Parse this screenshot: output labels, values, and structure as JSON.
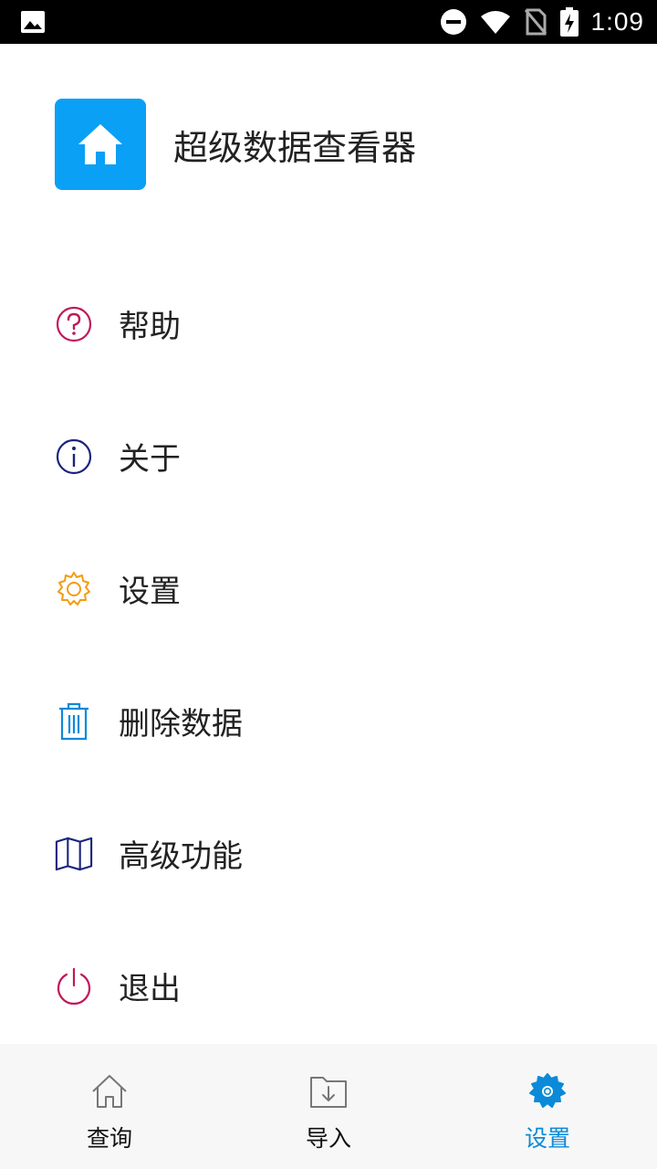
{
  "status_bar": {
    "time": "1:09"
  },
  "header": {
    "app_title": "超级数据查看器",
    "icon": "home-icon"
  },
  "menu": {
    "items": [
      {
        "label": "帮助",
        "icon": "help-circle-icon",
        "color": "#c2185b"
      },
      {
        "label": "关于",
        "icon": "info-circle-icon",
        "color": "#1a237e"
      },
      {
        "label": "设置",
        "icon": "gear-icon",
        "color": "#f39c12"
      },
      {
        "label": "删除数据",
        "icon": "trash-icon",
        "color": "#0a8ad8"
      },
      {
        "label": "高级功能",
        "icon": "map-icon",
        "color": "#1a237e"
      },
      {
        "label": "退出",
        "icon": "power-icon",
        "color": "#c2185b"
      }
    ]
  },
  "bottom_nav": {
    "items": [
      {
        "label": "查询",
        "icon": "home-outline-icon"
      },
      {
        "label": "导入",
        "icon": "import-folder-icon"
      },
      {
        "label": "设置",
        "icon": "settings-gear-icon",
        "active": true
      }
    ]
  },
  "colors": {
    "accent": "#0aa0f5",
    "active_nav": "#0a8ad8"
  }
}
